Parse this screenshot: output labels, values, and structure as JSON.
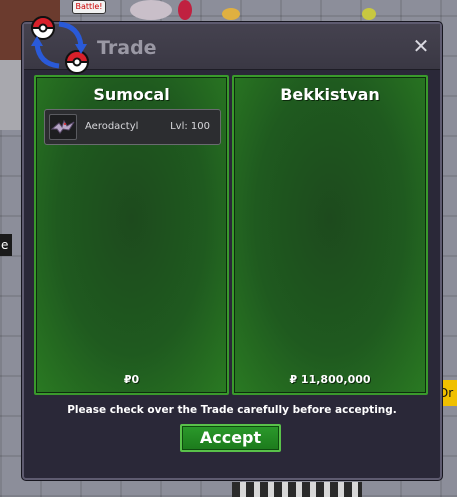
{
  "background": {
    "badge_text": "Battle!",
    "left_label": "e",
    "right_label": "Dr"
  },
  "window": {
    "title": "Trade",
    "close_glyph": "✕"
  },
  "offers": [
    {
      "player": "Sumocal",
      "money": "₽0",
      "pokemon": [
        {
          "name": "Aerodactyl",
          "level": "Lvl: 100"
        }
      ]
    },
    {
      "player": "Bekkistvan",
      "money": "₽ 11,800,000",
      "pokemon": []
    }
  ],
  "notice": "Please check over the Trade carefully before accepting.",
  "accept_label": "Accept",
  "colors": {
    "panel_green": "#1f5a1f",
    "panel_border": "#3a9a2c",
    "window_bg": "#2a2838",
    "accept_green": "#2b9a2b"
  },
  "icons": [
    "pokeball-swap-logo-icon",
    "close-icon",
    "aerodactyl-sprite-icon"
  ]
}
